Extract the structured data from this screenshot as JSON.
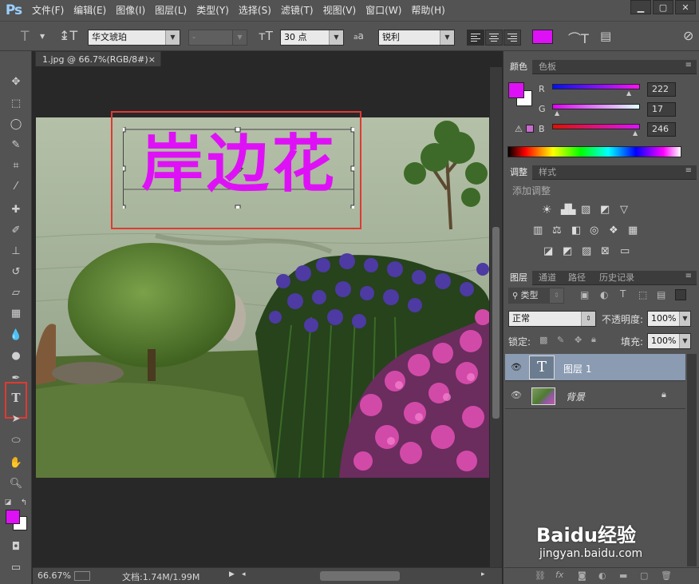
{
  "app": {
    "logo": "Ps"
  },
  "menu": [
    "文件(F)",
    "编辑(E)",
    "图像(I)",
    "图层(L)",
    "类型(Y)",
    "选择(S)",
    "滤镜(T)",
    "视图(V)",
    "窗口(W)",
    "帮助(H)"
  ],
  "options": {
    "font_family": "华文琥珀",
    "font_style": "-",
    "font_size": "30 点",
    "antialias_prefix": "a",
    "antialias": "锐利",
    "text_color": "#de11f6"
  },
  "document": {
    "tab_title": "1.jpg @ 66.7%(RGB/8#)",
    "text_layer_content": "岸边花",
    "zoom": "66.67%",
    "doc_size": "文档:1.74M/1.99M"
  },
  "color_panel": {
    "tabs": [
      "颜色",
      "色板"
    ],
    "r_label": "R",
    "g_label": "G",
    "b_label": "B",
    "r": "222",
    "g": "17",
    "b": "246",
    "foreground": "#de11f6",
    "background": "#ffffff"
  },
  "adjust_panel": {
    "tabs": [
      "调整",
      "样式"
    ],
    "hint": "添加调整"
  },
  "layers_panel": {
    "tabs": [
      "图层",
      "通道",
      "路径",
      "历史记录"
    ],
    "filter_kind": "类型",
    "blend_mode": "正常",
    "opacity_label": "不透明度:",
    "opacity": "100%",
    "lock_label": "锁定:",
    "fill_label": "填充:",
    "fill": "100%",
    "layers": [
      {
        "name": "图层 1",
        "selected": true
      },
      {
        "name": "背景",
        "selected": false
      }
    ]
  },
  "watermark": {
    "line1": "Baidu经验",
    "line2": "jingyan.baidu.com"
  }
}
